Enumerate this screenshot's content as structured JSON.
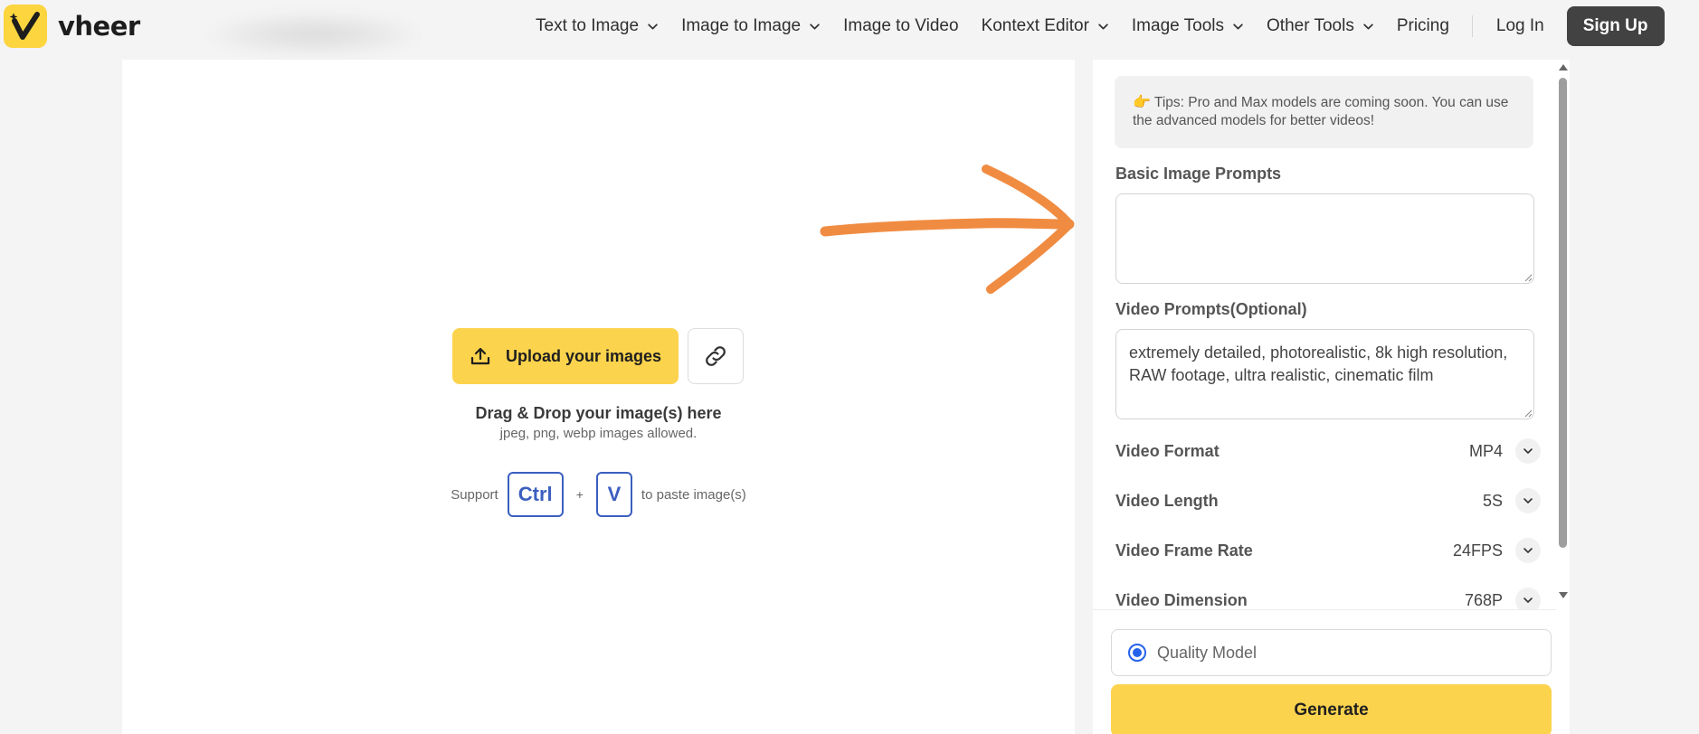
{
  "brand": {
    "name": "vheer",
    "accent": "#fcd34d"
  },
  "nav": {
    "items": [
      {
        "label": "Text to Image",
        "has_dropdown": true
      },
      {
        "label": "Image to Image",
        "has_dropdown": true
      },
      {
        "label": "Image to Video",
        "has_dropdown": false
      },
      {
        "label": "Kontext Editor",
        "has_dropdown": true
      },
      {
        "label": "Image Tools",
        "has_dropdown": true
      },
      {
        "label": "Other Tools",
        "has_dropdown": true
      },
      {
        "label": "Pricing",
        "has_dropdown": false
      }
    ],
    "login_label": "Log In",
    "signup_label": "Sign Up"
  },
  "upload": {
    "button_label": "Upload your images",
    "drag_title": "Drag & Drop your image(s) here",
    "drag_subtitle": "jpeg, png, webp images allowed.",
    "paste_prefix": "Support",
    "key_ctrl": "Ctrl",
    "plus": "+",
    "key_v": "V",
    "paste_suffix": "to paste image(s)"
  },
  "panel": {
    "tips": "Tips: Pro and Max models are coming soon. You can use the advanced models for better videos!",
    "basic_prompt_label": "Basic Image Prompts",
    "basic_prompt_value": "",
    "video_prompt_label": "Video Prompts(Optional)",
    "video_prompt_value": "extremely detailed, photorealistic, 8k high resolution, RAW footage, ultra realistic, cinematic film",
    "settings": [
      {
        "name": "Video Format",
        "value": "MP4"
      },
      {
        "name": "Video Length",
        "value": "5S"
      },
      {
        "name": "Video Frame Rate",
        "value": "24FPS"
      },
      {
        "name": "Video Dimension",
        "value": "768P"
      }
    ],
    "quality_model_label": "Quality Model",
    "generate_label": "Generate"
  }
}
